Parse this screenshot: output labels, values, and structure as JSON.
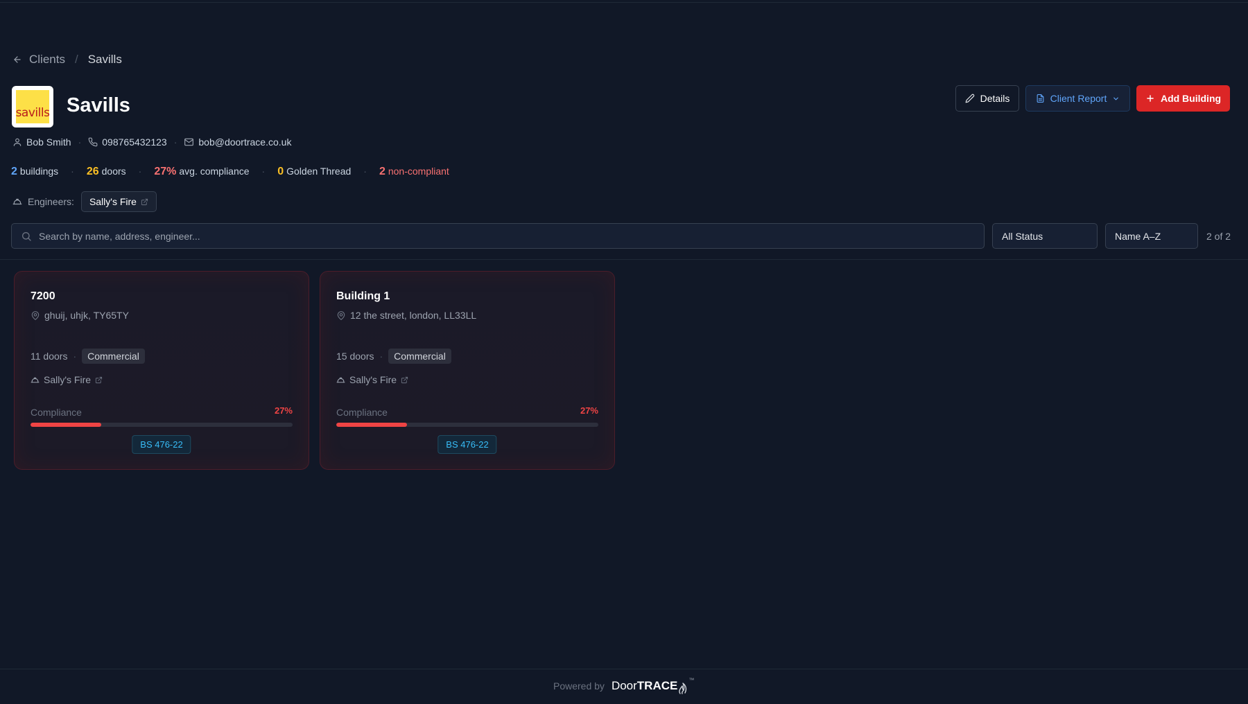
{
  "breadcrumb": {
    "parent": "Clients",
    "separator": "/",
    "current": "Savills"
  },
  "client": {
    "logo_text": "savills",
    "name": "Savills",
    "contact_name": "Bob Smith",
    "phone": "098765432123",
    "email": "bob@doortrace.co.uk"
  },
  "stats": {
    "buildings_count": "2",
    "buildings_label": "buildings",
    "doors_count": "26",
    "doors_label": "doors",
    "compliance_value": "27%",
    "compliance_label": "avg. compliance",
    "golden_count": "0",
    "golden_label": "Golden Thread",
    "noncompliant_count": "2",
    "noncompliant_label": "non-compliant"
  },
  "engineers": {
    "label": "Engineers:",
    "items": [
      "Sally's Fire"
    ]
  },
  "actions": {
    "details": "Details",
    "client_report": "Client Report",
    "add_building": "Add Building"
  },
  "filters": {
    "search_placeholder": "Search by name, address, engineer...",
    "status": "All Status",
    "sort": "Name A–Z",
    "count": "2 of 2"
  },
  "buildings": [
    {
      "name": "7200",
      "address": "ghuij, uhjk, TY65TY",
      "doors": "11 doors",
      "type": "Commercial",
      "engineer": "Sally's Fire",
      "compliance_label": "Compliance",
      "compliance": "27%",
      "compliance_value": 0.27,
      "standard": "BS 476-22"
    },
    {
      "name": "Building 1",
      "address": "12 the street, london, LL33LL",
      "doors": "15 doors",
      "type": "Commercial",
      "engineer": "Sally's Fire",
      "compliance_label": "Compliance",
      "compliance": "27%",
      "compliance_value": 0.27,
      "standard": "BS 476-22"
    }
  ],
  "footer": {
    "powered_by": "Powered by",
    "brand_a": "Door",
    "brand_b": "TRACE",
    "tm": "™"
  },
  "colors": {
    "background": "#111827",
    "accent_red": "#dc2626",
    "accent_blue": "#60a5fa",
    "stat_blue": "#60a5fa",
    "stat_yellow": "#fbbf24",
    "stat_red": "#f87171",
    "badge_cyan": "#38bdf8"
  }
}
